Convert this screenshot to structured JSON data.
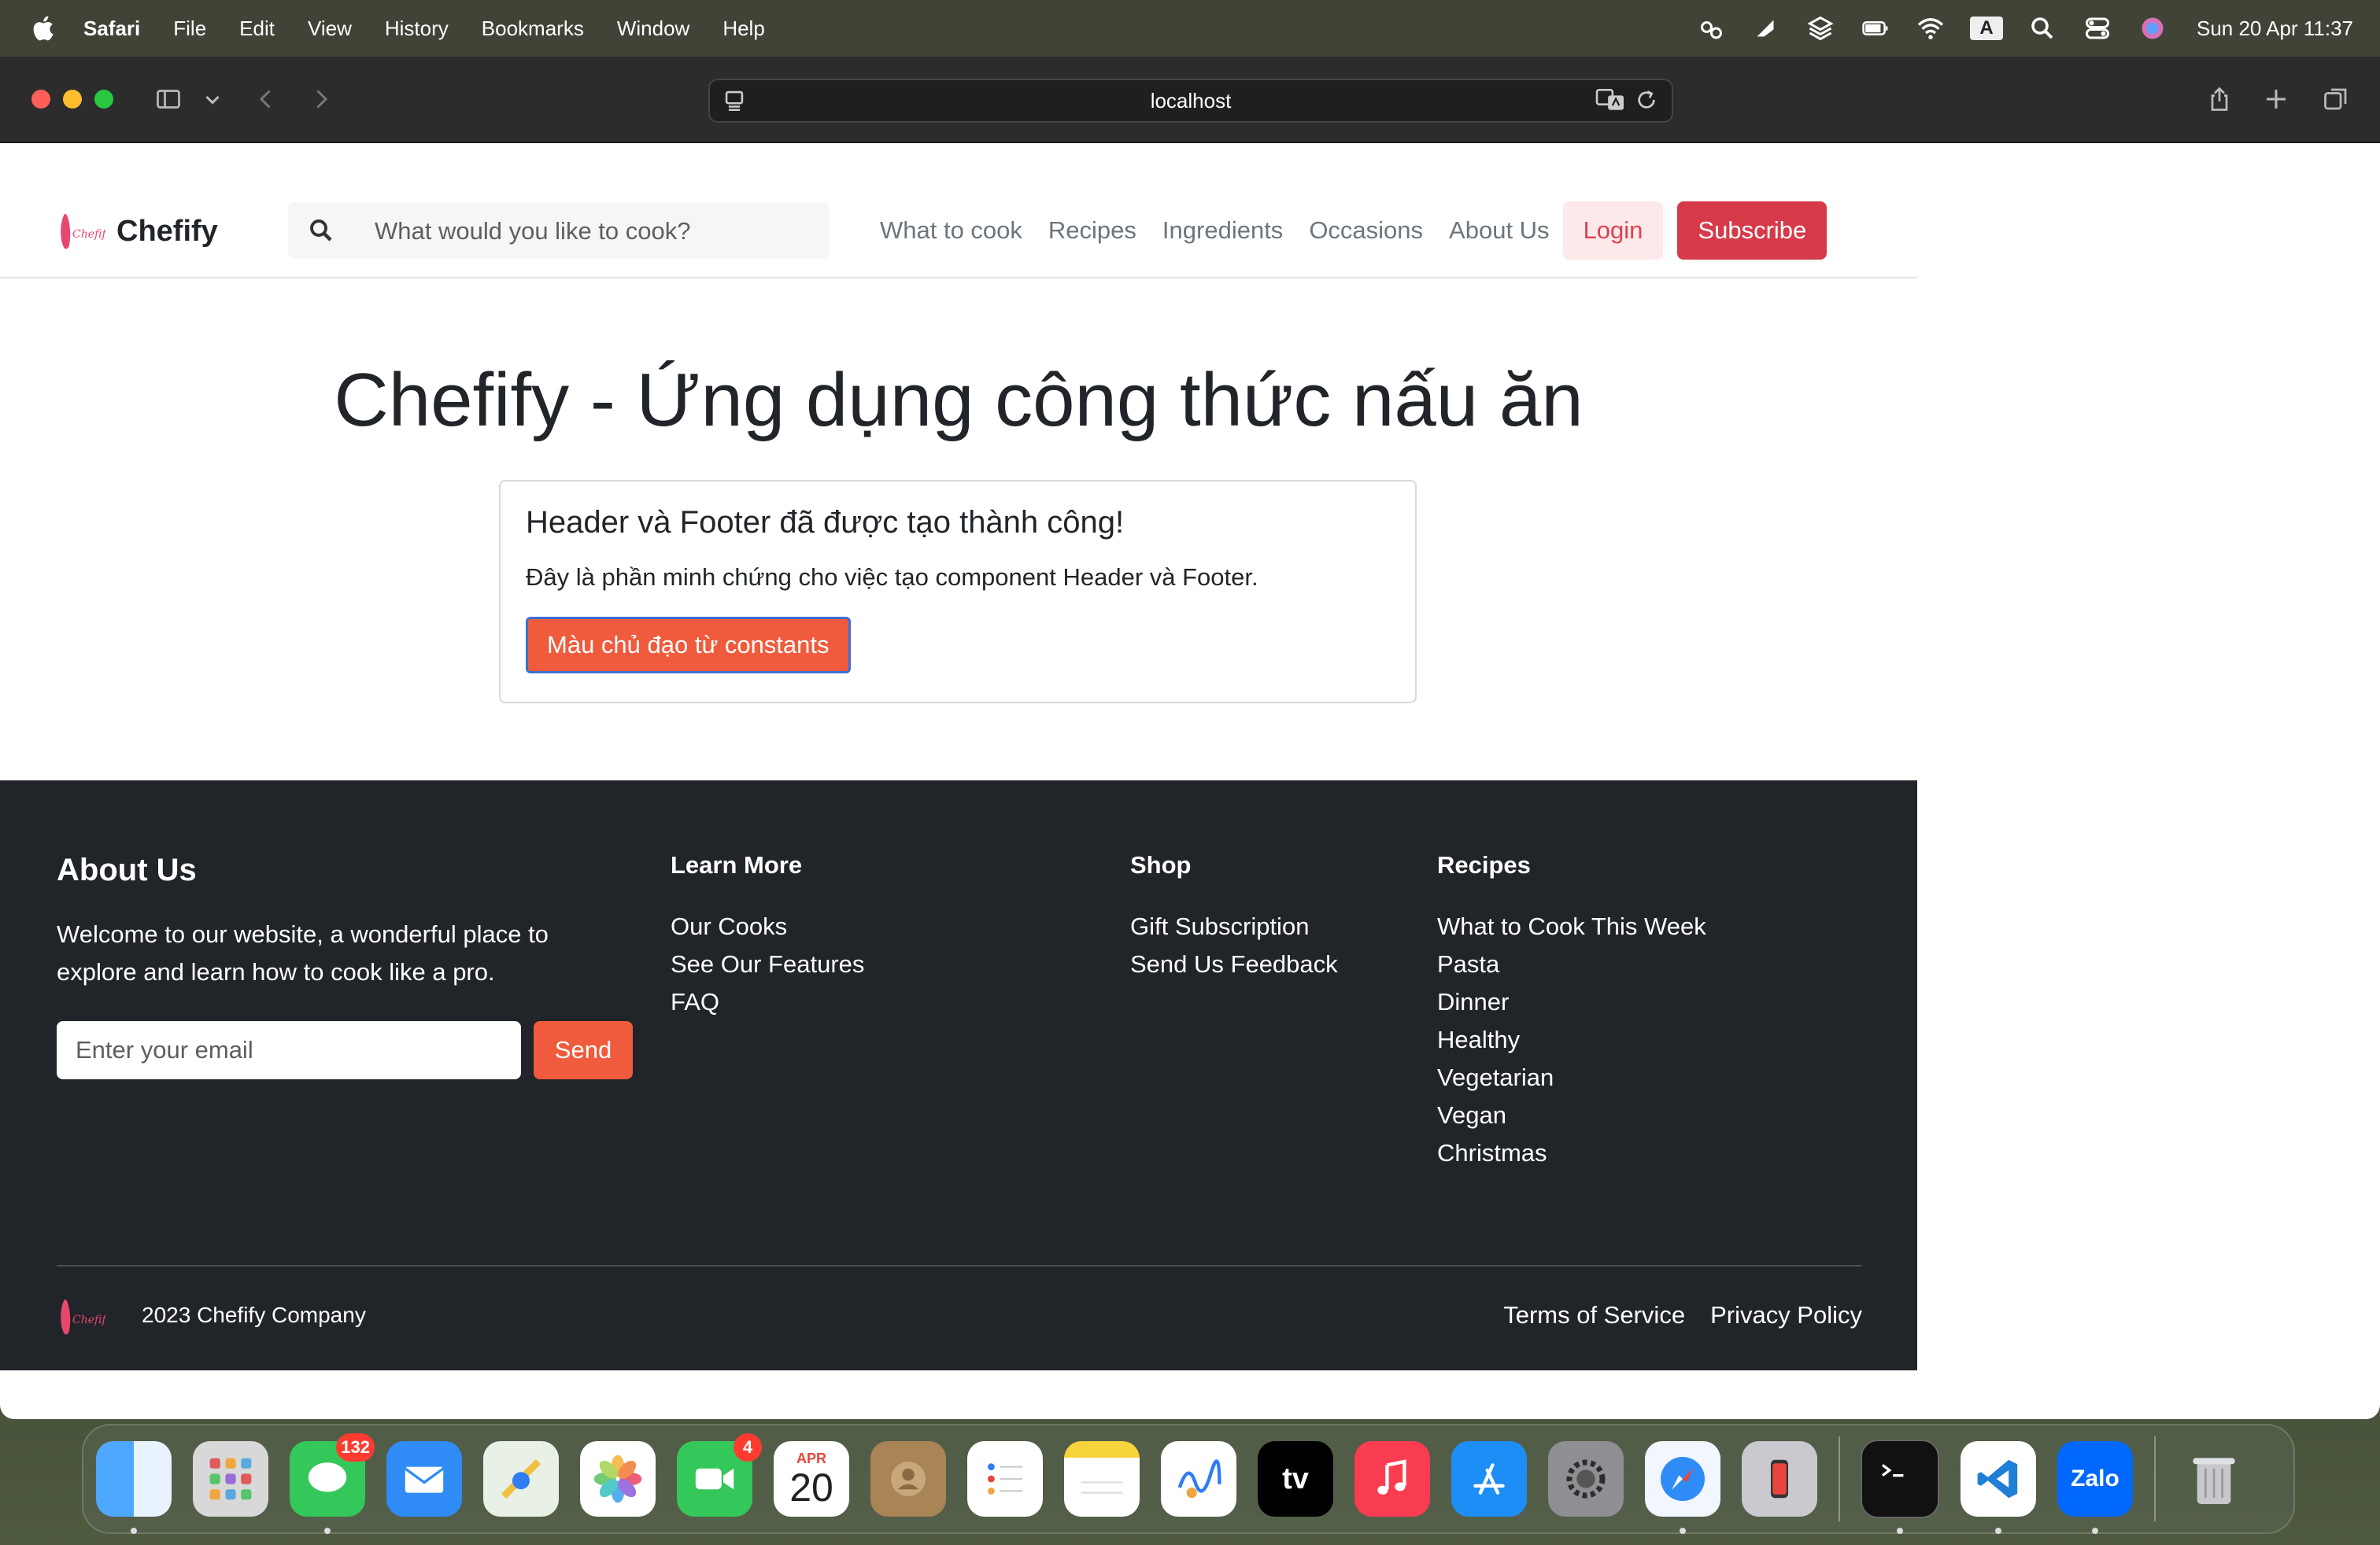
{
  "menubar": {
    "app_name": "Safari",
    "items": [
      "File",
      "Edit",
      "View",
      "History",
      "Bookmarks",
      "Window",
      "Help"
    ],
    "input_source": "A",
    "clock": "Sun 20 Apr  11:37"
  },
  "browser": {
    "url": "localhost"
  },
  "header": {
    "logo_mark_text": "Chefify",
    "logo_text": "Chefify",
    "search_placeholder": "What would you like to cook?",
    "nav": [
      "What to cook",
      "Recipes",
      "Ingredients",
      "Occasions",
      "About Us"
    ],
    "login_label": "Login",
    "subscribe_label": "Subscribe"
  },
  "main": {
    "title": "Chefify - Ứng dụng công thức nấu ăn",
    "card_title": "Header và Footer đã được tạo thành công!",
    "card_text": "Đây là phần minh chứng cho việc tạo component Header và Footer.",
    "card_button": "Màu chủ đạo từ constants"
  },
  "footer": {
    "about_title": "About Us",
    "about_text": "Welcome to our website, a wonderful place to explore and learn how to cook like a pro.",
    "email_placeholder": "Enter your email",
    "send_label": "Send",
    "learn_more": {
      "title": "Learn More",
      "links": [
        "Our Cooks",
        "See Our Features",
        "FAQ"
      ]
    },
    "shop": {
      "title": "Shop",
      "links": [
        "Gift Subscription",
        "Send Us Feedback"
      ]
    },
    "recipes": {
      "title": "Recipes",
      "links": [
        "What to Cook This Week",
        "Pasta",
        "Dinner",
        "Healthy",
        "Vegetarian",
        "Vegan",
        "Christmas"
      ]
    },
    "logo_text": "Chefify",
    "copyright": "2023 Chefify Company",
    "terms": "Terms of Service",
    "privacy": "Privacy Policy"
  },
  "dock": {
    "messages_badge": "132",
    "facetime_badge": "4",
    "calendar_month": "APR",
    "calendar_day": "20",
    "tv_label": "tv",
    "zalo_label": "Zalo"
  },
  "colors": {
    "brand_red": "#d63a48",
    "primary_orange": "#ef5b3c",
    "footer_bg": "#212429"
  }
}
